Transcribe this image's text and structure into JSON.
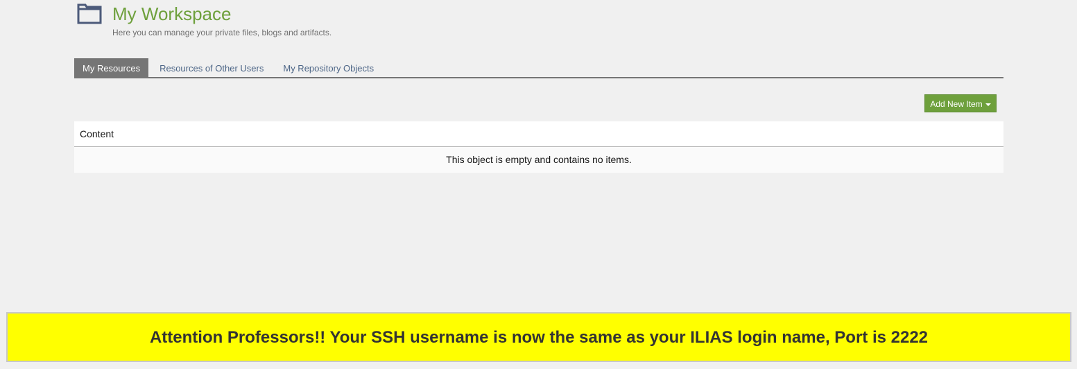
{
  "header": {
    "icon": "folder-icon",
    "title": "My Workspace",
    "subtitle": "Here you can manage your private files, blogs and artifacts.",
    "title_color": "#6ea03c"
  },
  "tabs": [
    {
      "label": "My Resources",
      "active": true
    },
    {
      "label": "Resources of Other Users",
      "active": false
    },
    {
      "label": "My Repository Objects",
      "active": false
    }
  ],
  "toolbar": {
    "add_new_item_label": "Add New Item",
    "add_new_item_icon": "caret-down-icon",
    "button_color": "#6ea03c"
  },
  "content_panel": {
    "header": "Content",
    "empty_message": "This object is empty and contains no items."
  },
  "banner": {
    "text": "Attention Professors!! Your SSH username is now the same as your ILIAS login name, Port is 2222",
    "background_color": "#ffff00"
  }
}
